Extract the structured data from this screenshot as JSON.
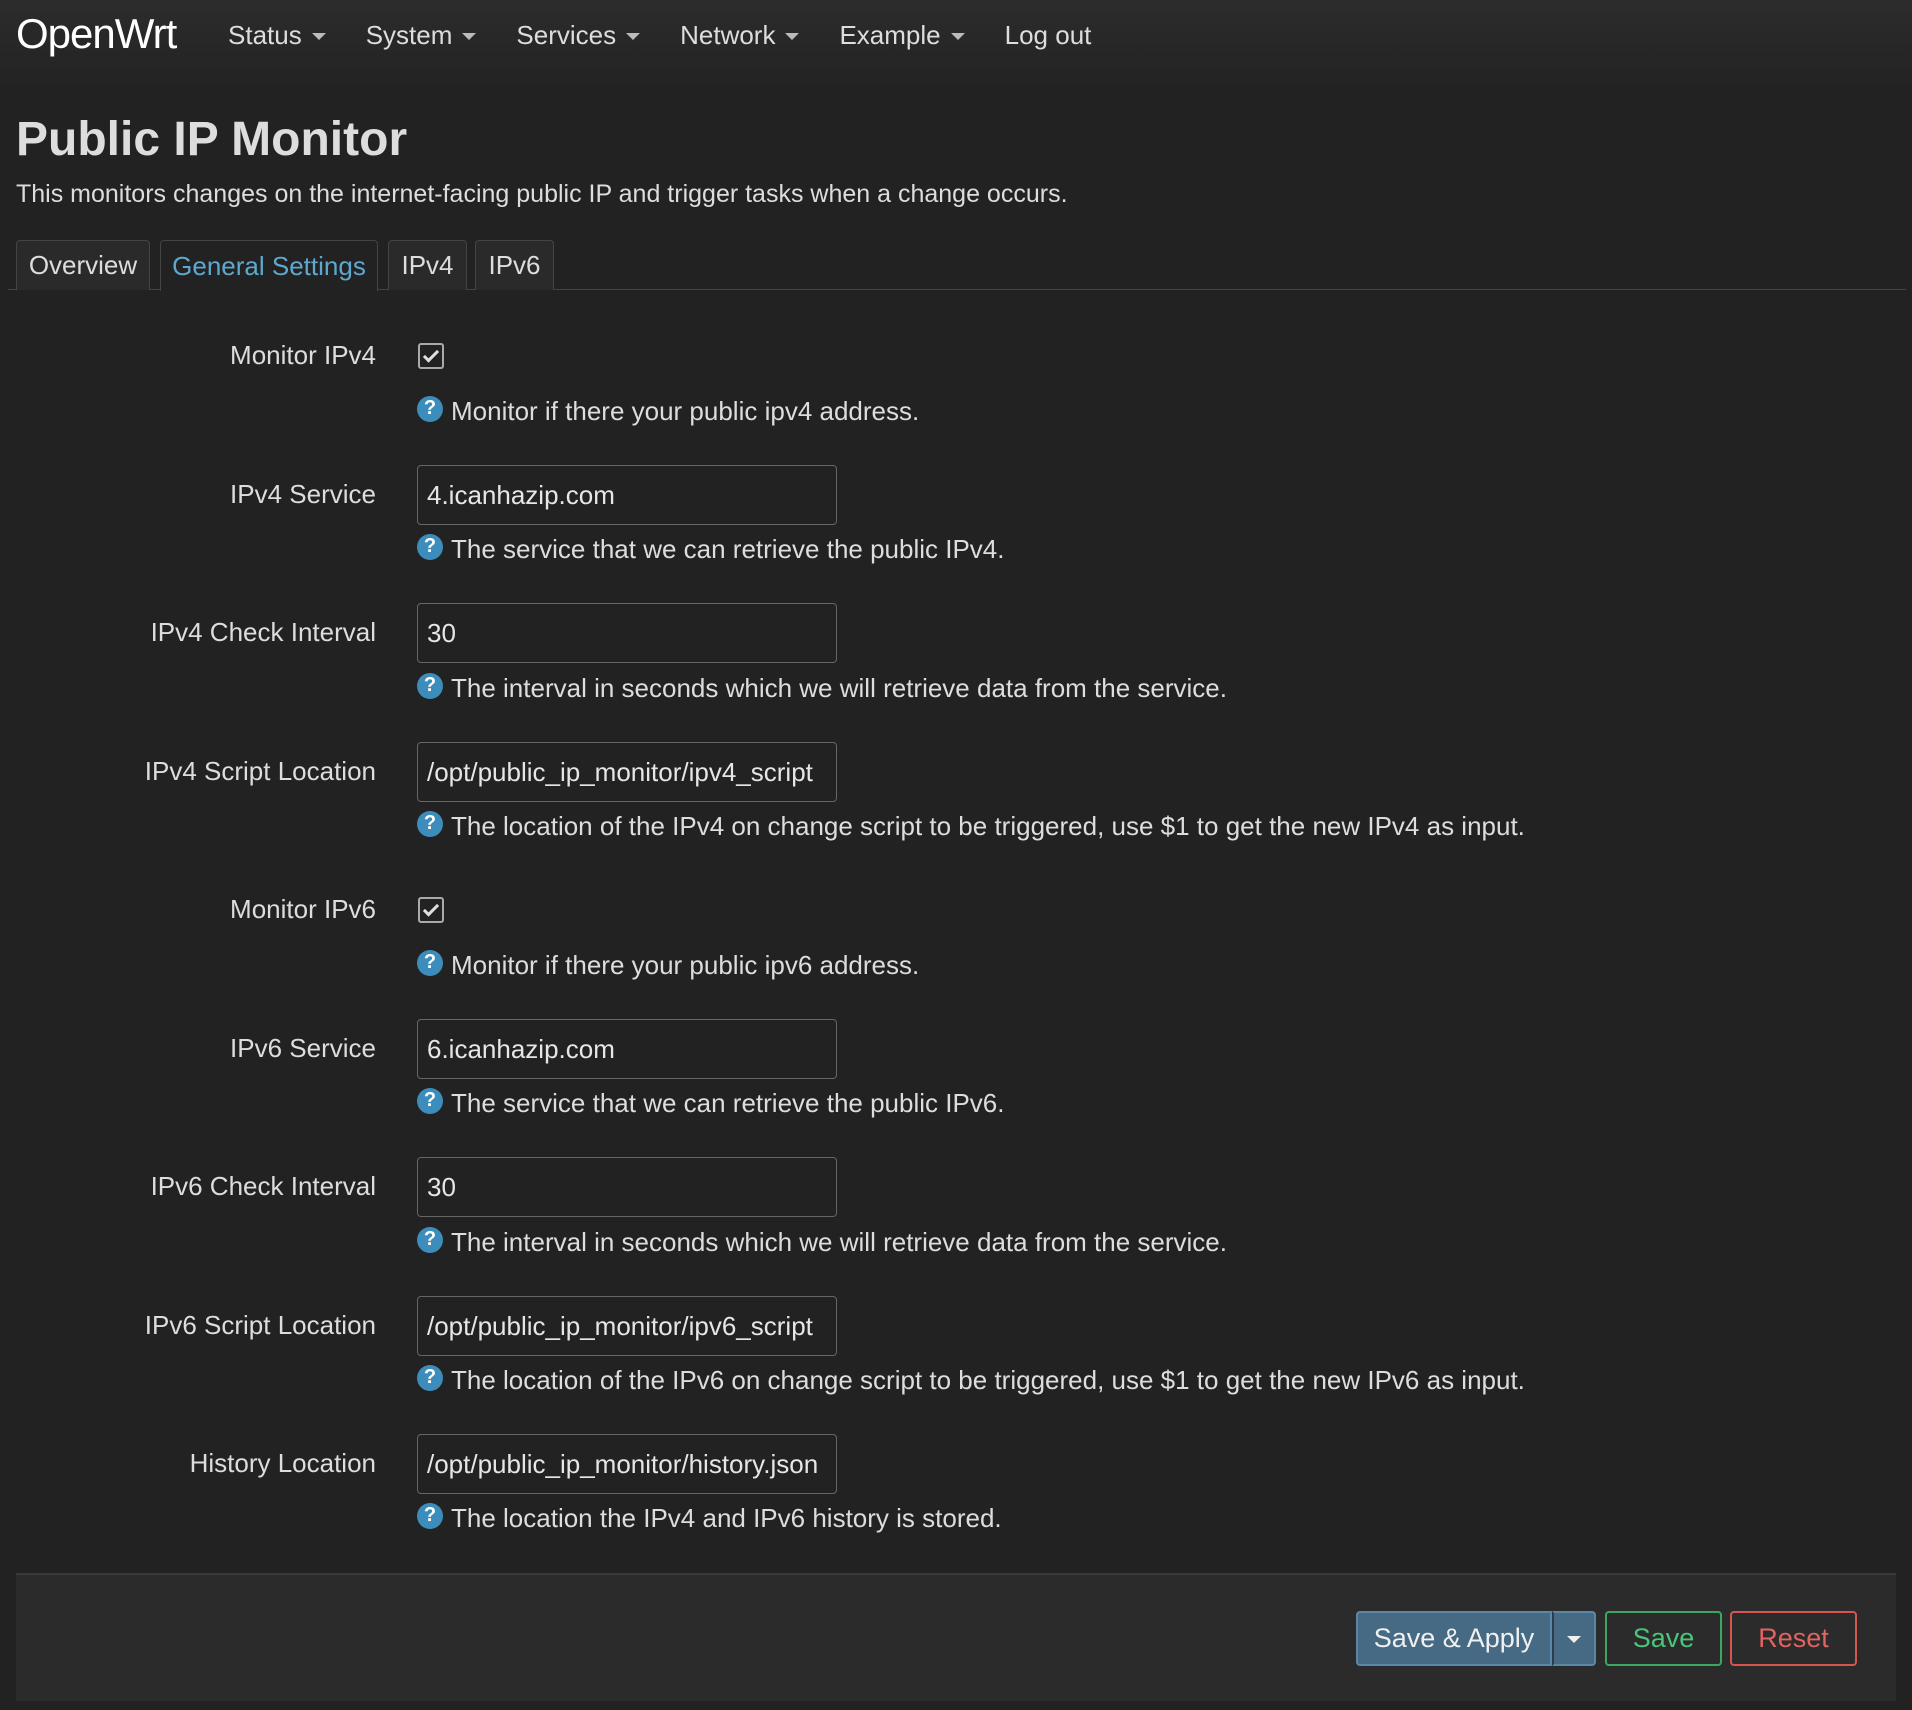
{
  "header": {
    "brand": "OpenWrt",
    "nav": [
      {
        "label": "Status"
      },
      {
        "label": "System"
      },
      {
        "label": "Services"
      },
      {
        "label": "Network"
      },
      {
        "label": "Example"
      },
      {
        "label": "Log out"
      }
    ]
  },
  "page": {
    "title": "Public IP Monitor",
    "description": "This monitors changes on the internet-facing public IP and trigger tasks when a change occurs."
  },
  "tabs": [
    {
      "label": "Overview"
    },
    {
      "label": "General Settings",
      "active": true
    },
    {
      "label": "IPv4"
    },
    {
      "label": "IPv6"
    }
  ],
  "form": {
    "monitor_ipv4": {
      "label": "Monitor IPv4",
      "checked": true,
      "help": "Monitor if there your public ipv4 address."
    },
    "ipv4_service": {
      "label": "IPv4 Service",
      "value": "4.icanhazip.com",
      "help": "The service that we can retrieve the public IPv4."
    },
    "ipv4_interval": {
      "label": "IPv4 Check Interval",
      "value": "30",
      "help": "The interval in seconds which we will retrieve data from the service."
    },
    "ipv4_script": {
      "label": "IPv4 Script Location",
      "value": "/opt/public_ip_monitor/ipv4_script",
      "help": "The location of the IPv4 on change script to be triggered, use $1 to get the new IPv4 as input."
    },
    "monitor_ipv6": {
      "label": "Monitor IPv6",
      "checked": true,
      "help": "Monitor if there your public ipv6 address."
    },
    "ipv6_service": {
      "label": "IPv6 Service",
      "value": "6.icanhazip.com",
      "help": "The service that we can retrieve the public IPv6."
    },
    "ipv6_interval": {
      "label": "IPv6 Check Interval",
      "value": "30",
      "help": "The interval in seconds which we will retrieve data from the service."
    },
    "ipv6_script": {
      "label": "IPv6 Script Location",
      "value": "/opt/public_ip_monitor/ipv6_script",
      "help": "The location of the IPv6 on change script to be triggered, use $1 to get the new IPv6 as input."
    },
    "history": {
      "label": "History Location",
      "value": "/opt/public_ip_monitor/history.json",
      "help": "The location the IPv4 and IPv6 history is stored."
    }
  },
  "help_icon": {
    "glyph": "?",
    "icon": "question-circle-icon",
    "color": "#3c8dbc"
  },
  "actions": {
    "save_apply": "Save & Apply",
    "save": "Save",
    "reset": "Reset"
  },
  "colors": {
    "background": "#222222",
    "accent": "#5ea8cf",
    "save": "#4bc57a",
    "reset": "#e06460",
    "apply": "#466a83"
  }
}
